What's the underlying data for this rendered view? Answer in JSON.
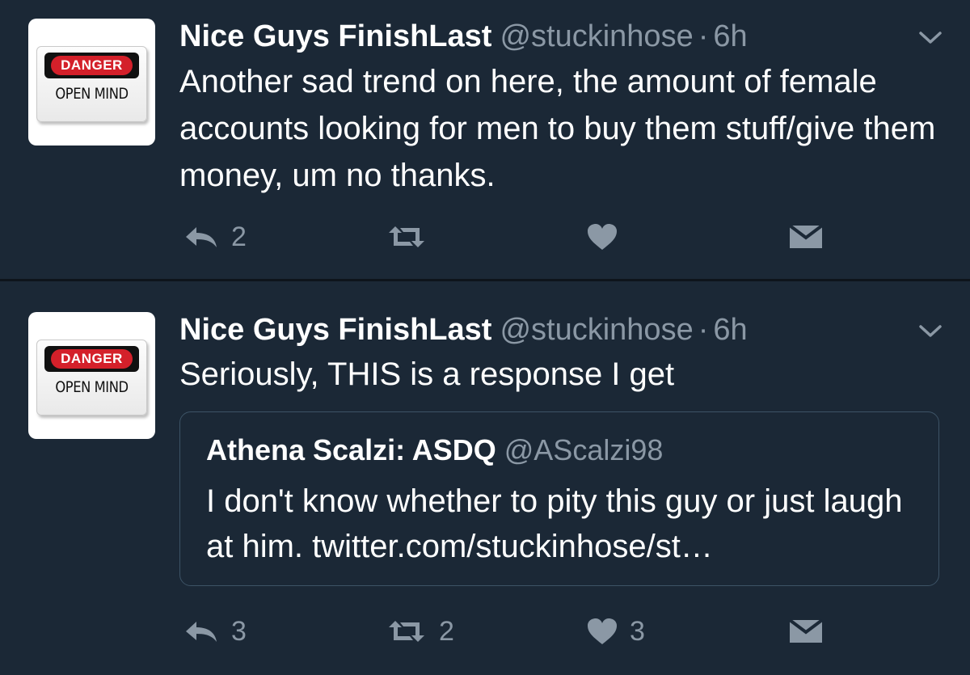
{
  "colors": {
    "background": "#1b2836",
    "text_primary": "#ffffff",
    "text_secondary": "#8b98a5",
    "divider": "#0e141b",
    "danger_red": "#d4202a"
  },
  "avatar_sign": {
    "top_text": "DANGER",
    "bottom_text": "OPEN MIND"
  },
  "tweets": [
    {
      "author_name": "Nice Guys FinishLast",
      "handle": "@stuckinhose",
      "separator": "·",
      "time": "6h",
      "text": "Another sad trend on here, the amount of female accounts looking for men to buy them stuff/give them money, um no thanks.",
      "reply_count": "2",
      "retweet_count": "",
      "like_count": "",
      "icons": [
        "caret-down-icon",
        "reply-icon",
        "retweet-icon",
        "heart-icon",
        "direct-message-icon"
      ]
    },
    {
      "author_name": "Nice Guys FinishLast",
      "handle": "@stuckinhose",
      "separator": "·",
      "time": "6h",
      "text": "Seriously, THIS is a response I get",
      "reply_count": "3",
      "retweet_count": "2",
      "like_count": "3",
      "quoted": {
        "author_name": "Athena Scalzi: ASDQ",
        "handle": "@AScalzi98",
        "text": "I don't know whether to pity this guy or just laugh at him. twitter.com/stuckinhose/st…"
      },
      "icons": [
        "caret-down-icon",
        "reply-icon",
        "retweet-icon",
        "heart-icon",
        "direct-message-icon"
      ]
    }
  ]
}
